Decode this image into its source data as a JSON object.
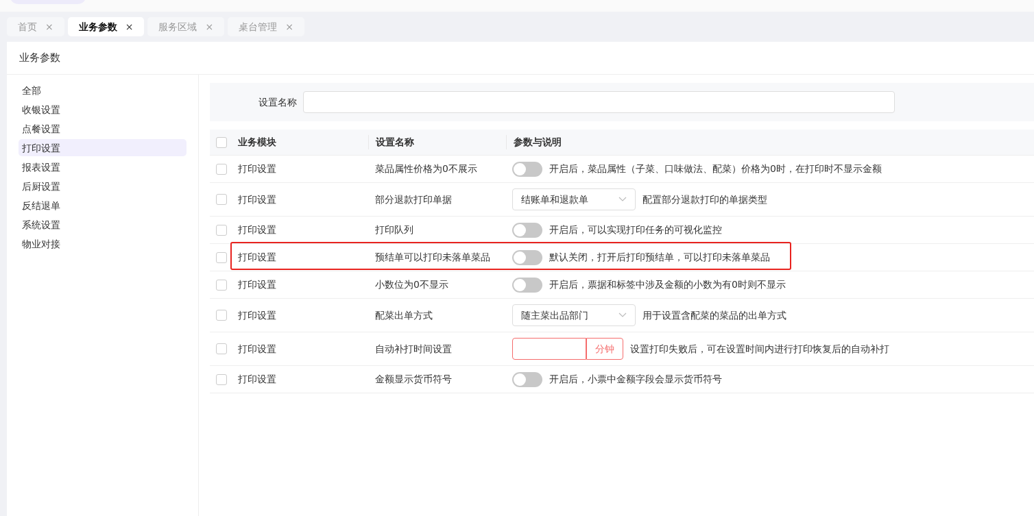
{
  "tabs": [
    {
      "label": "首页",
      "selected": false,
      "close": "×"
    },
    {
      "label": "业务参数",
      "selected": true,
      "close": "×"
    },
    {
      "label": "服务区域",
      "selected": false,
      "close": "×"
    },
    {
      "label": "桌台管理",
      "selected": false,
      "close": "×"
    }
  ],
  "page_title": "业务参数",
  "sidebar": {
    "items": [
      {
        "label": "全部",
        "selected": false
      },
      {
        "label": "收银设置",
        "selected": false
      },
      {
        "label": "点餐设置",
        "selected": false
      },
      {
        "label": "打印设置",
        "selected": true
      },
      {
        "label": "报表设置",
        "selected": false
      },
      {
        "label": "后厨设置",
        "selected": false
      },
      {
        "label": "反结退单",
        "selected": false
      },
      {
        "label": "系统设置",
        "selected": false
      },
      {
        "label": "物业对接",
        "selected": false
      }
    ]
  },
  "filter": {
    "label": "设置名称"
  },
  "table": {
    "header_checked": false,
    "columns": [
      "业务模块",
      "设置名称",
      "参数与说明"
    ],
    "rows": [
      {
        "checked": false,
        "highlighted": false,
        "module": "打印设置",
        "name": "菜品属性价格为0不展示",
        "kind": "toggle",
        "on": false,
        "description": "开启后，菜品属性（子菜、口味做法、配菜）价格为0时，在打印时不显示金额"
      },
      {
        "checked": false,
        "highlighted": false,
        "module": "打印设置",
        "name": "部分退款打印单据",
        "kind": "select",
        "value": "结账单和退款单",
        "description": "配置部分退款打印的单据类型"
      },
      {
        "checked": false,
        "highlighted": false,
        "module": "打印设置",
        "name": "打印队列",
        "kind": "toggle",
        "on": false,
        "description": "开启后，可以实现打印任务的可视化监控"
      },
      {
        "checked": false,
        "highlighted": true,
        "module": "打印设置",
        "name": "预结单可以打印未落单菜品",
        "kind": "toggle",
        "on": false,
        "description": "默认关闭，打开后打印预结单，可以打印未落单菜品"
      },
      {
        "checked": false,
        "highlighted": false,
        "module": "打印设置",
        "name": "小数位为0不显示",
        "kind": "toggle",
        "on": false,
        "description": "开启后，票据和标签中涉及金额的小数为有0时则不显示"
      },
      {
        "checked": false,
        "highlighted": false,
        "module": "打印设置",
        "name": "配菜出单方式",
        "kind": "select",
        "value": "随主菜出品部门",
        "description": "用于设置含配菜的菜品的出单方式"
      },
      {
        "checked": false,
        "highlighted": false,
        "module": "打印设置",
        "name": "自动补打时间设置",
        "kind": "input",
        "error": true,
        "suffix": "分钟",
        "description": "设置打印失败后，可在设置时间内进行打印恢复后的自动补打"
      },
      {
        "checked": false,
        "highlighted": false,
        "module": "打印设置",
        "name": "金额显示货币符号",
        "kind": "toggle",
        "on": false,
        "description": "开启后，小票中金额字段会显示货币符号"
      }
    ]
  }
}
